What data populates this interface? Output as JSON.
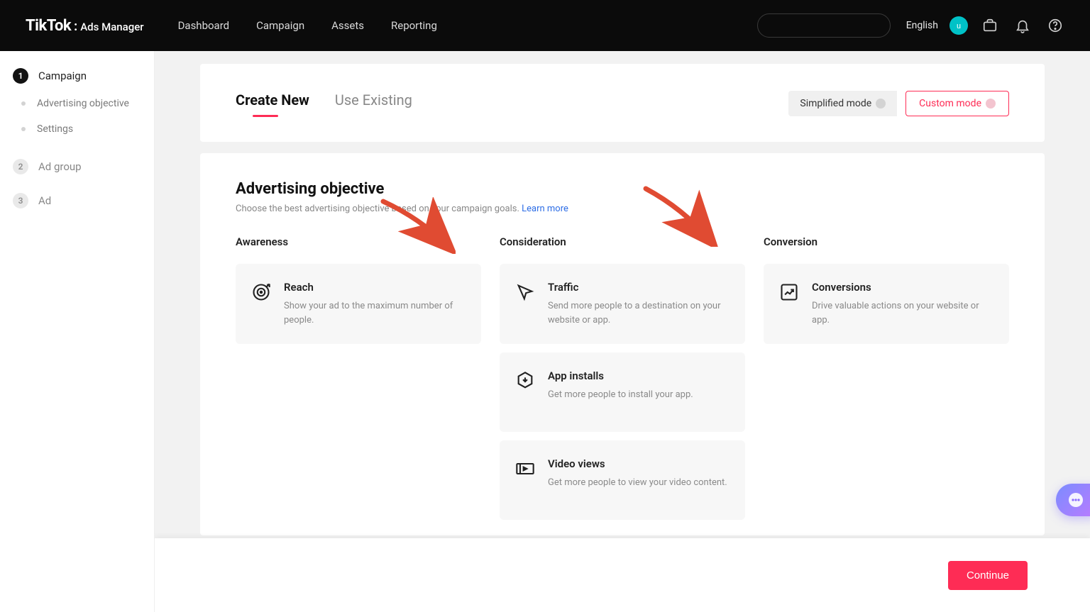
{
  "header": {
    "brand_main": "TikTok",
    "brand_sep": ":",
    "brand_sub": "Ads Manager",
    "nav": [
      "Dashboard",
      "Campaign",
      "Assets",
      "Reporting"
    ],
    "language": "English",
    "avatar_initial": "u"
  },
  "sidebar": {
    "steps": [
      {
        "num": "1",
        "label": "Campaign",
        "active": true,
        "subs": [
          "Advertising objective",
          "Settings"
        ]
      },
      {
        "num": "2",
        "label": "Ad group",
        "active": false,
        "subs": []
      },
      {
        "num": "3",
        "label": "Ad",
        "active": false,
        "subs": []
      }
    ]
  },
  "tabs": {
    "create_new": "Create New",
    "use_existing": "Use Existing"
  },
  "mode": {
    "simplified": "Simplified mode",
    "custom": "Custom mode"
  },
  "objective_section": {
    "title": "Advertising objective",
    "subtitle": "Choose the best advertising objective based on your campaign goals. ",
    "learn_more": "Learn more"
  },
  "columns": {
    "awareness": {
      "heading": "Awareness",
      "items": [
        {
          "name": "Reach",
          "desc": "Show your ad to the maximum number of people."
        }
      ]
    },
    "consideration": {
      "heading": "Consideration",
      "items": [
        {
          "name": "Traffic",
          "desc": "Send more people to a destination on your website or app."
        },
        {
          "name": "App installs",
          "desc": "Get more people to install your app."
        },
        {
          "name": "Video views",
          "desc": "Get more people to view your video content."
        }
      ]
    },
    "conversion": {
      "heading": "Conversion",
      "items": [
        {
          "name": "Conversions",
          "desc": "Drive valuable actions on your website or app."
        }
      ]
    }
  },
  "footer": {
    "continue": "Continue"
  }
}
